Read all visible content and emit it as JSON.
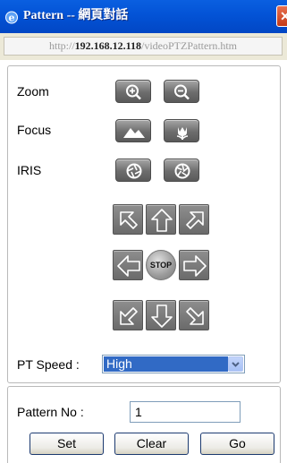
{
  "window": {
    "title": "Pattern -- 網頁對話",
    "close_glyph": "✕"
  },
  "address": {
    "prefix": "http://",
    "host": "192.168.12.118",
    "path": "/videoPTZPattern.htm"
  },
  "camera": {
    "zoom_label": "Zoom",
    "focus_label": "Focus",
    "iris_label": "IRIS",
    "stop_label": "STOP",
    "pt_speed_label": "PT Speed :",
    "pt_speed_value": "High"
  },
  "pattern": {
    "no_label": "Pattern No :",
    "no_value": "1",
    "set_label": "Set",
    "clear_label": "Clear",
    "go_label": "Go"
  },
  "icons": {
    "zoom_in": "zoom-in-icon",
    "zoom_out": "zoom-out-icon",
    "focus_far": "mountain-icon",
    "focus_near": "flower-icon",
    "iris_open": "iris-open-icon",
    "iris_close": "iris-close-icon"
  },
  "colors": {
    "titlebar": "#0353d6",
    "selection": "#316ac5",
    "button_gray": "#6d6d6d"
  }
}
